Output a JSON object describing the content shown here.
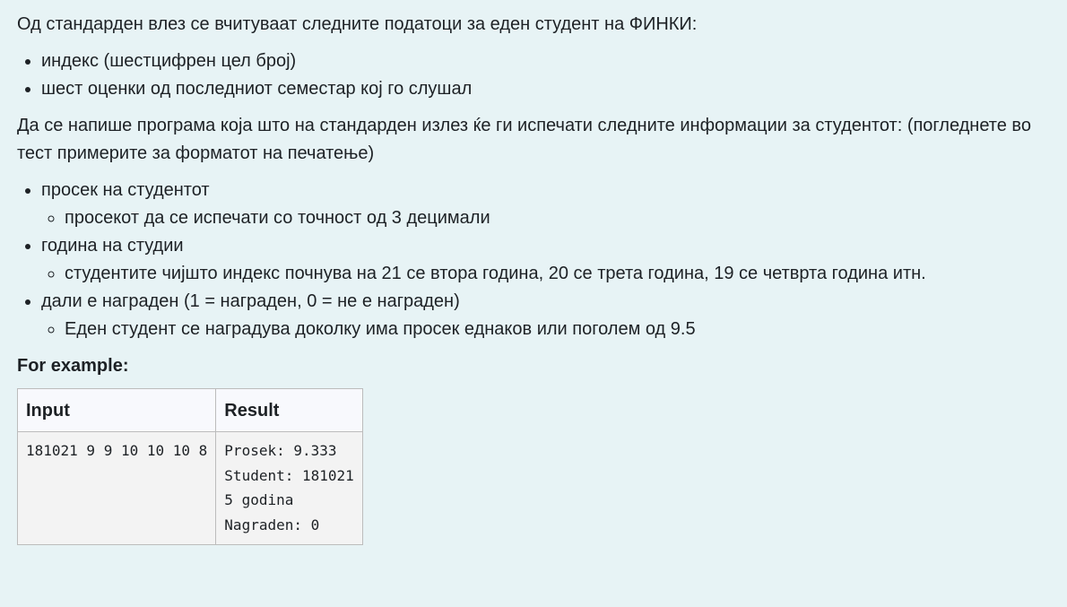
{
  "intro": "Од стандарден влез се вчитуваат следните податоци за еден студент на ФИНКИ:",
  "input_items": [
    "индекс (шестцифрен цел број)",
    "шест оценки од последниот семестар кој го слушал"
  ],
  "output_paragraph": "Да се напише програма која што на стандарден излез ќе ги испечати следните информации за студентот: (погледнете во тест примерите за форматот на печатење)",
  "output_items": [
    {
      "label": "просек на студентот",
      "sub": "просекот да се испечати со точност од 3 децимали"
    },
    {
      "label": "година на студии",
      "sub": "студентите чијшто индекс почнува на 21 се втора година, 20 се трета година, 19 се четврта година итн."
    },
    {
      "label": "дали е награден (1 = награден, 0 = не е награден)",
      "sub": "Еден студент се наградува доколку има просек еднаков или поголем од 9.5"
    }
  ],
  "example": {
    "heading": "For example:",
    "col_input": "Input",
    "col_result": "Result",
    "input_value": "181021 9 9 10 10 10 8",
    "result_value": "Prosek: 9.333\nStudent: 181021\n5 godina\nNagraden: 0"
  }
}
